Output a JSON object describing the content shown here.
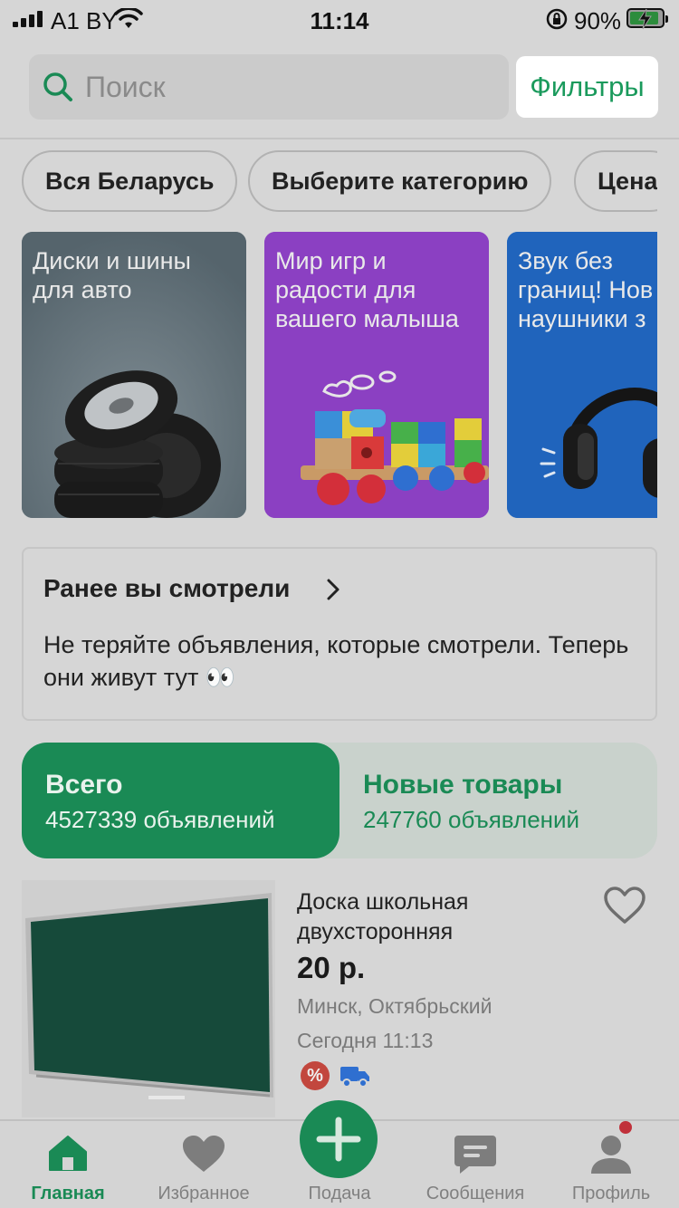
{
  "status_bar": {
    "carrier": "A1 BY",
    "time": "11:14",
    "battery_percent": "90%",
    "battery_level": 0.9
  },
  "search": {
    "placeholder": "Поиск",
    "filters_label": "Фильтры"
  },
  "chips": [
    {
      "label": "Вся Беларусь"
    },
    {
      "label": "Выберите категорию"
    },
    {
      "label": "Цена"
    }
  ],
  "banners": [
    {
      "title": "Диски и шины\nдля авто",
      "icon": "tires-icon"
    },
    {
      "title": "Мир игр и\nрадости для\nвашего малыша",
      "icon": "toy-train-icon"
    },
    {
      "title": "Звук без\nграниц! Нов\nнаушники з",
      "icon": "headphones-icon"
    }
  ],
  "recently_viewed": {
    "title": "Ранее вы смотрели",
    "text": "Не теряйте объявления, которые смотрели. Теперь они живут тут 👀"
  },
  "counters": {
    "all": {
      "label": "Всего",
      "count": "4527339 объявлений"
    },
    "new": {
      "label": "Новые товары",
      "count": "247760 объявлений"
    }
  },
  "listing": {
    "title": "Доска школьная двухсторонняя",
    "price": "20 р.",
    "location": "Минск, Октябрьский",
    "date": "Сегодня 11:13",
    "discount_badge": "%"
  },
  "tabbar": {
    "home": "Главная",
    "favorites": "Избранное",
    "post": "Подача",
    "messages": "Сообщения",
    "profile": "Профиль"
  },
  "colors": {
    "accent": "#1a8a55",
    "filters_text": "#1a9a5c",
    "notification": "#c0303a"
  }
}
